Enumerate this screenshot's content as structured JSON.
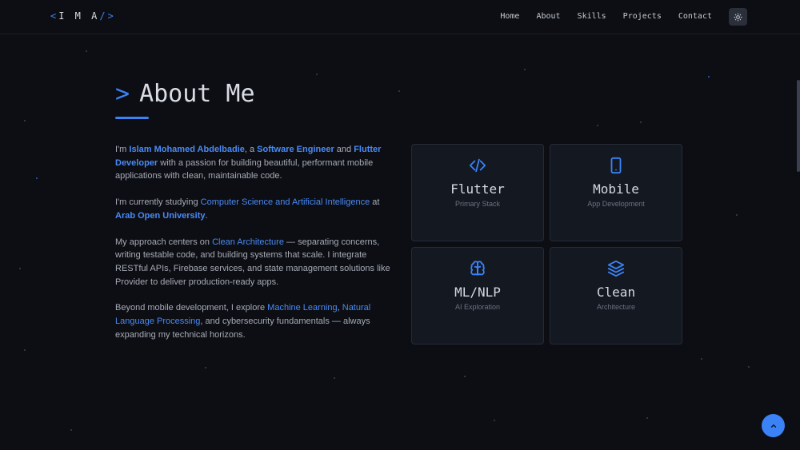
{
  "logo": {
    "open": "<",
    "letters": "I M A",
    "close": "/>"
  },
  "nav": {
    "items": [
      "Home",
      "About",
      "Skills",
      "Projects",
      "Contact"
    ]
  },
  "section": {
    "caret": ">",
    "title": "About Me"
  },
  "about": {
    "p1": {
      "t1": "I'm ",
      "name": "Islam Mohamed Abdelbadie",
      "t2": ", a ",
      "role1": "Software Engineer",
      "t3": " and ",
      "role2": "Flutter Developer",
      "t4": " with a passion for building beautiful, performant mobile applications with clean, maintainable code."
    },
    "p2": {
      "t1": "I'm currently studying ",
      "field": "Computer Science and Artificial Intelligence",
      "t2": " at ",
      "uni": "Arab Open University",
      "t3": "."
    },
    "p3": {
      "t1": "My approach centers on ",
      "arch": "Clean Architecture",
      "t2": " — separating concerns, writing testable code, and building systems that scale. I integrate RESTful APIs, Firebase services, and state management solutions like Provider to deliver production-ready apps."
    },
    "p4": {
      "t1": "Beyond mobile development, I explore ",
      "ml": "Machine Learning",
      "t2": ", ",
      "nlp": "Natural Language Processing",
      "t3": ", and cybersecurity fundamentals — always expanding my technical horizons."
    }
  },
  "cards": [
    {
      "icon": "code-icon",
      "title": "Flutter",
      "subtitle": "Primary Stack"
    },
    {
      "icon": "smartphone-icon",
      "title": "Mobile",
      "subtitle": "App Development"
    },
    {
      "icon": "brain-icon",
      "title": "ML/NLP",
      "subtitle": "AI Exploration"
    },
    {
      "icon": "layers-icon",
      "title": "Clean",
      "subtitle": "Architecture"
    }
  ],
  "colors": {
    "accent": "#3b82f6",
    "background": "#0c0e14",
    "card": "#141821"
  }
}
